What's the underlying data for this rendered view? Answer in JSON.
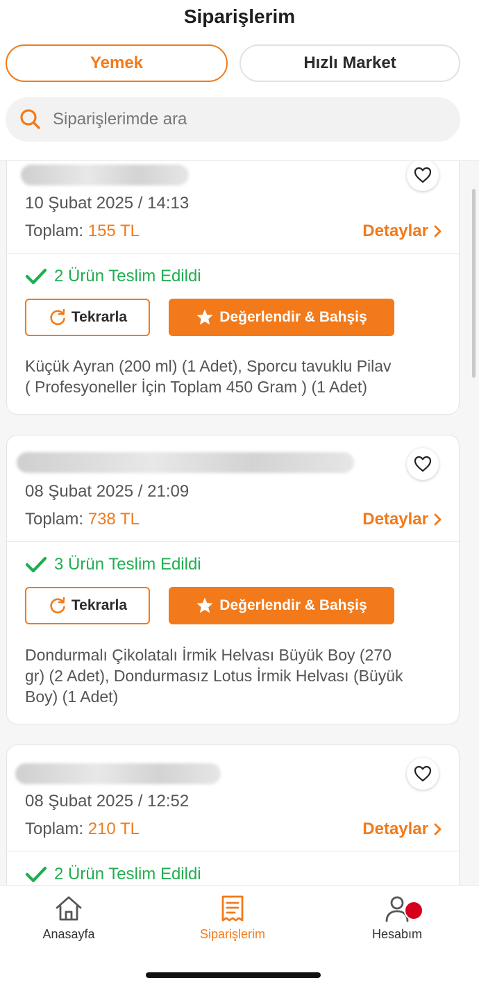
{
  "header": {
    "title": "Siparişlerim",
    "tabs": [
      {
        "label": "Yemek",
        "active": true
      },
      {
        "label": "Hızlı Market",
        "active": false
      }
    ],
    "search": {
      "placeholder": "Siparişlerimde ara"
    }
  },
  "orders": [
    {
      "date": "10 Şubat 2025 / 14:13",
      "total_label": "Toplam:",
      "total_value": "155 TL",
      "details_label": "Detaylar",
      "status": "2 Ürün Teslim Edildi",
      "repeat_label": "Tekrarla",
      "rate_label": "Değerlendir & Bahşiş",
      "items_line1": "Küçük Ayran (200 ml) (1 Adet), Sporcu tavuklu Pilav",
      "items_line2": "( Profesyoneller İçin Toplam 450 Gram ) (1 Adet)",
      "items_line3": ""
    },
    {
      "date": "08 Şubat 2025 / 21:09",
      "total_label": "Toplam:",
      "total_value": "738 TL",
      "details_label": "Detaylar",
      "status": "3 Ürün Teslim Edildi",
      "repeat_label": "Tekrarla",
      "rate_label": "Değerlendir & Bahşiş",
      "items_line1": "Dondurmalı Çikolatalı İrmik Helvası Büyük Boy (270",
      "items_line2": "gr) (2 Adet), Dondurmasız Lotus İrmik Helvası (Büyük",
      "items_line3": "Boy) (1 Adet)"
    },
    {
      "date": "08 Şubat 2025 / 12:52",
      "total_label": "Toplam:",
      "total_value": "210 TL",
      "details_label": "Detaylar",
      "status": "2 Ürün Teslim Edildi"
    }
  ],
  "bottom_nav": [
    {
      "label": "Anasayfa",
      "icon": "home-icon",
      "active": false
    },
    {
      "label": "Siparişlerim",
      "icon": "orders-icon",
      "active": true
    },
    {
      "label": "Hesabım",
      "icon": "account-icon",
      "active": false,
      "badge": true
    }
  ],
  "colors": {
    "accent": "#f27a1a",
    "success": "#1fae4f",
    "badge": "#d6001c"
  }
}
